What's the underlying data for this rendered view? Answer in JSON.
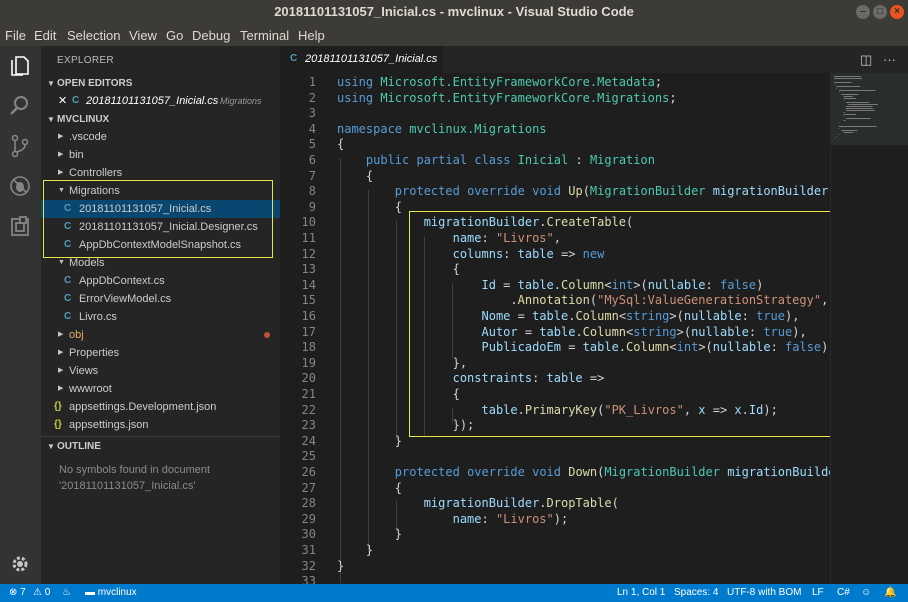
{
  "window": {
    "title": "20181101131057_Inicial.cs - mvclinux - Visual Studio Code"
  },
  "menu": [
    {
      "label": "File"
    },
    {
      "label": "Edit"
    },
    {
      "label": "Selection"
    },
    {
      "label": "View"
    },
    {
      "label": "Go"
    },
    {
      "label": "Debug"
    },
    {
      "label": "Terminal"
    },
    {
      "label": "Help"
    }
  ],
  "activity": [
    "files-icon",
    "search-icon",
    "source-control-icon",
    "debug-icon",
    "extensions-icon",
    "gear-icon"
  ],
  "sidebar": {
    "header": "EXPLORER",
    "open_editors_label": "OPEN EDITORS",
    "open_editor": {
      "name": "20181101131057_Inicial.cs",
      "folder": "Migrations"
    },
    "project_label": "MVCLINUX",
    "tree": [
      {
        "label": ".vscode",
        "type": "folder"
      },
      {
        "label": "bin",
        "type": "folder"
      },
      {
        "label": "Controllers",
        "type": "folder"
      },
      {
        "label": "Migrations",
        "type": "folder-open"
      },
      {
        "label": "20181101131057_Inicial.cs",
        "type": "cs",
        "selected": true
      },
      {
        "label": "20181101131057_Inicial.Designer.cs",
        "type": "cs"
      },
      {
        "label": "AppDbContextModelSnapshot.cs",
        "type": "cs"
      },
      {
        "label": "Models",
        "type": "folder-open"
      },
      {
        "label": "AppDbContext.cs",
        "type": "cs"
      },
      {
        "label": "ErrorViewModel.cs",
        "type": "cs"
      },
      {
        "label": "Livro.cs",
        "type": "cs"
      },
      {
        "label": "obj",
        "type": "folder",
        "modified": true
      },
      {
        "label": "Properties",
        "type": "folder"
      },
      {
        "label": "Views",
        "type": "folder"
      },
      {
        "label": "wwwroot",
        "type": "folder"
      },
      {
        "label": "appsettings.Development.json",
        "type": "json"
      },
      {
        "label": "appsettings.json",
        "type": "json"
      }
    ],
    "outline_label": "OUTLINE",
    "outline_msg_1": "No symbols found in document",
    "outline_msg_2": "'20181101131057_Inicial.cs'"
  },
  "tab": {
    "label": "20181101131057_Inicial.cs",
    "split_icon": "split-editor-icon",
    "more_icon": "more-icon"
  },
  "code_lines": [
    {
      "n": "1",
      "html": "<span class='kw'>using</span> <span class='ty'>Microsoft.EntityFrameworkCore.Metadata</span>;"
    },
    {
      "n": "2",
      "html": "<span class='kw'>using</span> <span class='ty'>Microsoft.EntityFrameworkCore.Migrations</span>;"
    },
    {
      "n": "3",
      "html": ""
    },
    {
      "n": "4",
      "html": "<span class='kw'>namespace</span> <span class='ty'>mvclinux.Migrations</span>"
    },
    {
      "n": "5",
      "html": "{"
    },
    {
      "n": "6",
      "html": "    <span class='kw'>public</span> <span class='kw'>partial</span> <span class='kw'>class</span> <span class='ty'>Inicial</span> : <span class='ty'>Migration</span>"
    },
    {
      "n": "7",
      "html": "    {"
    },
    {
      "n": "8",
      "html": "        <span class='kw'>protected</span> <span class='kw'>override</span> <span class='kw'>void</span> <span class='fn'>Up</span>(<span class='ty'>MigrationBuilder</span> <span class='nm'>migrationBuilder</span>)"
    },
    {
      "n": "9",
      "html": "        {"
    },
    {
      "n": "10",
      "html": "            <span class='nm'>migrationBuilder</span>.<span class='fn'>CreateTable</span>("
    },
    {
      "n": "11",
      "html": "                <span class='nm'>name</span>: <span class='st'>\"Livros\"</span>,"
    },
    {
      "n": "12",
      "html": "                <span class='nm'>columns</span>: <span class='nm'>table</span> => <span class='kw'>new</span>"
    },
    {
      "n": "13",
      "html": "                {"
    },
    {
      "n": "14",
      "html": "                    <span class='nm'>Id</span> = <span class='nm'>table</span>.<span class='fn'>Column</span>&lt;<span class='kw'>int</span>&gt;(<span class='nm'>nullable</span>: <span class='kw'>false</span>)"
    },
    {
      "n": "15",
      "html": "                        .<span class='fn'>Annotation</span>(<span class='st'>\"MySql:ValueGenerationStrategy\"</span>, <span class='nm'>MySq</span>"
    },
    {
      "n": "16",
      "html": "                    <span class='nm'>Nome</span> = <span class='nm'>table</span>.<span class='fn'>Column</span>&lt;<span class='kw'>string</span>&gt;(<span class='nm'>nullable</span>: <span class='kw'>true</span>),"
    },
    {
      "n": "17",
      "html": "                    <span class='nm'>Autor</span> = <span class='nm'>table</span>.<span class='fn'>Column</span>&lt;<span class='kw'>string</span>&gt;(<span class='nm'>nullable</span>: <span class='kw'>true</span>),"
    },
    {
      "n": "18",
      "html": "                    <span class='nm'>PublicadoEm</span> = <span class='nm'>table</span>.<span class='fn'>Column</span>&lt;<span class='kw'>int</span>&gt;(<span class='nm'>nullable</span>: <span class='kw'>false</span>)"
    },
    {
      "n": "19",
      "html": "                },"
    },
    {
      "n": "20",
      "html": "                <span class='nm'>constraints</span>: <span class='nm'>table</span> =>"
    },
    {
      "n": "21",
      "html": "                {"
    },
    {
      "n": "22",
      "html": "                    <span class='nm'>table</span>.<span class='fn'>PrimaryKey</span>(<span class='st'>\"PK_Livros\"</span>, <span class='nm'>x</span> => <span class='nm'>x</span>.<span class='nm'>Id</span>);"
    },
    {
      "n": "23",
      "html": "                });"
    },
    {
      "n": "24",
      "html": "        }"
    },
    {
      "n": "25",
      "html": ""
    },
    {
      "n": "26",
      "html": "        <span class='kw'>protected</span> <span class='kw'>override</span> <span class='kw'>void</span> <span class='fn'>Down</span>(<span class='ty'>MigrationBuilder</span> <span class='nm'>migrationBuilder</span>)"
    },
    {
      "n": "27",
      "html": "        {"
    },
    {
      "n": "28",
      "html": "            <span class='nm'>migrationBuilder</span>.<span class='fn'>DropTable</span>("
    },
    {
      "n": "29",
      "html": "                <span class='nm'>name</span>: <span class='st'>\"Livros\"</span>);"
    },
    {
      "n": "30",
      "html": "        }"
    },
    {
      "n": "31",
      "html": "    }"
    },
    {
      "n": "32",
      "html": "}"
    },
    {
      "n": "33",
      "html": ""
    }
  ],
  "status": {
    "errors": "7",
    "warnings": "0",
    "folder": "mvclinux",
    "position": "Ln 1, Col 1",
    "spaces": "Spaces: 4",
    "encoding": "UTF-8 with BOM",
    "eol": "LF",
    "language": "C#",
    "accent": "#007acc"
  }
}
